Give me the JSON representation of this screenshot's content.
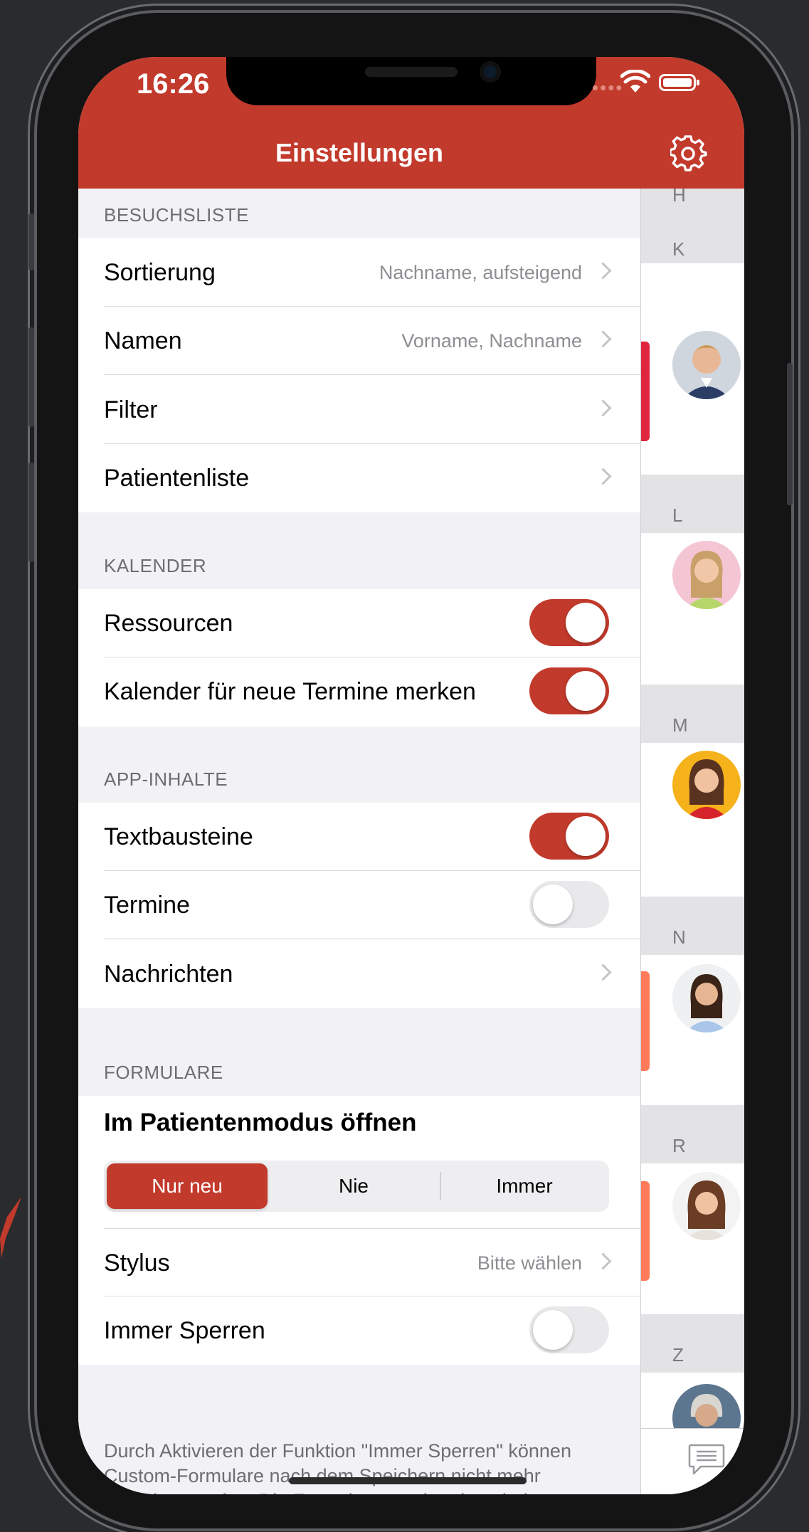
{
  "status": {
    "time": "16:26"
  },
  "header": {
    "title": "Einstellungen"
  },
  "sections": {
    "besuchsliste": {
      "header": "BESUCHSLISTE",
      "rows": [
        {
          "label": "Sortierung",
          "value": "Nachname, aufsteigend"
        },
        {
          "label": "Namen",
          "value": "Vorname, Nachname"
        },
        {
          "label": "Filter"
        },
        {
          "label": "Patientenliste"
        }
      ]
    },
    "kalender": {
      "header": "KALENDER",
      "rows": [
        {
          "label": "Ressourcen",
          "toggle": true
        },
        {
          "label": "Kalender für neue Termine merken",
          "toggle": true
        }
      ]
    },
    "app_inhalte": {
      "header": "APP-INHALTE",
      "rows": [
        {
          "label": "Textbausteine",
          "toggle": true
        },
        {
          "label": "Termine",
          "toggle": false
        },
        {
          "label": "Nachrichten"
        }
      ]
    },
    "formulare": {
      "header": "FORMULARE",
      "patient_mode_label": "Im Patientenmodus öffnen",
      "segments": [
        "Nur neu",
        "Nie",
        "Immer"
      ],
      "selected_segment": "Nur neu",
      "rows": [
        {
          "label": "Stylus",
          "value": "Bitte wählen"
        },
        {
          "label": "Immer Sperren",
          "toggle": false
        }
      ],
      "footer": "Durch Aktivieren der Funktion \"Immer Sperren\" können Custom-Formulare nach dem Speichern nicht mehr geändert werden. Die Formulare werden dann beim Speichern automatisch für eine nachträgliche Bearbeitung gesperrt. Sie benötigen"
    }
  },
  "patient_list": {
    "letters": [
      "H",
      "K",
      "L",
      "M",
      "N",
      "R",
      "Z"
    ]
  },
  "colors": {
    "accent": "#c23a2c",
    "marker_red": "#e0263d",
    "marker_orange": "#ff7a59"
  },
  "icons": [
    "gear-icon",
    "chevron-right-icon",
    "wifi-icon",
    "battery-icon",
    "chat-icon"
  ]
}
